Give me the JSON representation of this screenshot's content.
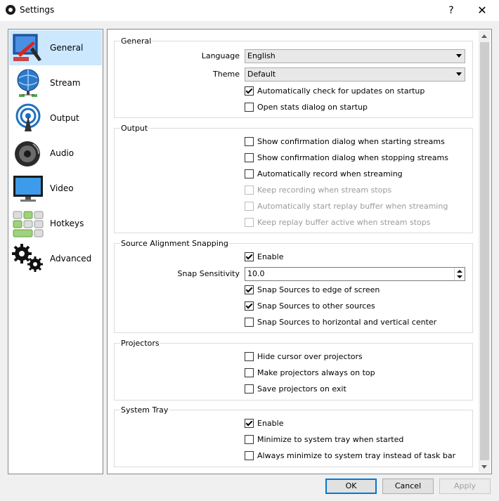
{
  "window": {
    "title": "Settings",
    "help_label": "?",
    "close_label": "✕"
  },
  "sidebar": {
    "items": [
      {
        "label": "General",
        "icon": "general-icon",
        "selected": true
      },
      {
        "label": "Stream",
        "icon": "stream-icon"
      },
      {
        "label": "Output",
        "icon": "output-icon"
      },
      {
        "label": "Audio",
        "icon": "audio-icon"
      },
      {
        "label": "Video",
        "icon": "video-icon"
      },
      {
        "label": "Hotkeys",
        "icon": "hotkeys-icon"
      },
      {
        "label": "Advanced",
        "icon": "advanced-icon"
      }
    ]
  },
  "general": {
    "title": "General",
    "language_label": "Language",
    "language_value": "English",
    "theme_label": "Theme",
    "theme_value": "Default",
    "check_updates": {
      "label": "Automatically check for updates on startup",
      "checked": true
    },
    "open_stats": {
      "label": "Open stats dialog on startup",
      "checked": false
    }
  },
  "output": {
    "title": "Output",
    "items": [
      {
        "label": "Show confirmation dialog when starting streams",
        "checked": false,
        "enabled": true
      },
      {
        "label": "Show confirmation dialog when stopping streams",
        "checked": false,
        "enabled": true
      },
      {
        "label": "Automatically record when streaming",
        "checked": false,
        "enabled": true
      },
      {
        "label": "Keep recording when stream stops",
        "checked": false,
        "enabled": false
      },
      {
        "label": "Automatically start replay buffer when streaming",
        "checked": false,
        "enabled": false
      },
      {
        "label": "Keep replay buffer active when stream stops",
        "checked": false,
        "enabled": false
      }
    ]
  },
  "snapping": {
    "title": "Source Alignment Snapping",
    "enable": {
      "label": "Enable",
      "checked": true
    },
    "sensitivity_label": "Snap Sensitivity",
    "sensitivity_value": "10.0",
    "edge": {
      "label": "Snap Sources to edge of screen",
      "checked": true
    },
    "other": {
      "label": "Snap Sources to other sources",
      "checked": true
    },
    "center": {
      "label": "Snap Sources to horizontal and vertical center",
      "checked": false
    }
  },
  "projectors": {
    "title": "Projectors",
    "items": [
      {
        "label": "Hide cursor over projectors",
        "checked": false
      },
      {
        "label": "Make projectors always on top",
        "checked": false
      },
      {
        "label": "Save projectors on exit",
        "checked": false
      }
    ]
  },
  "tray": {
    "title": "System Tray",
    "items": [
      {
        "label": "Enable",
        "checked": true
      },
      {
        "label": "Minimize to system tray when started",
        "checked": false
      },
      {
        "label": "Always minimize to system tray instead of task bar",
        "checked": false
      }
    ]
  },
  "buttons": {
    "ok": "OK",
    "cancel": "Cancel",
    "apply": "Apply"
  },
  "colors": {
    "selection": "#cce8ff",
    "accent": "#0078d7"
  }
}
